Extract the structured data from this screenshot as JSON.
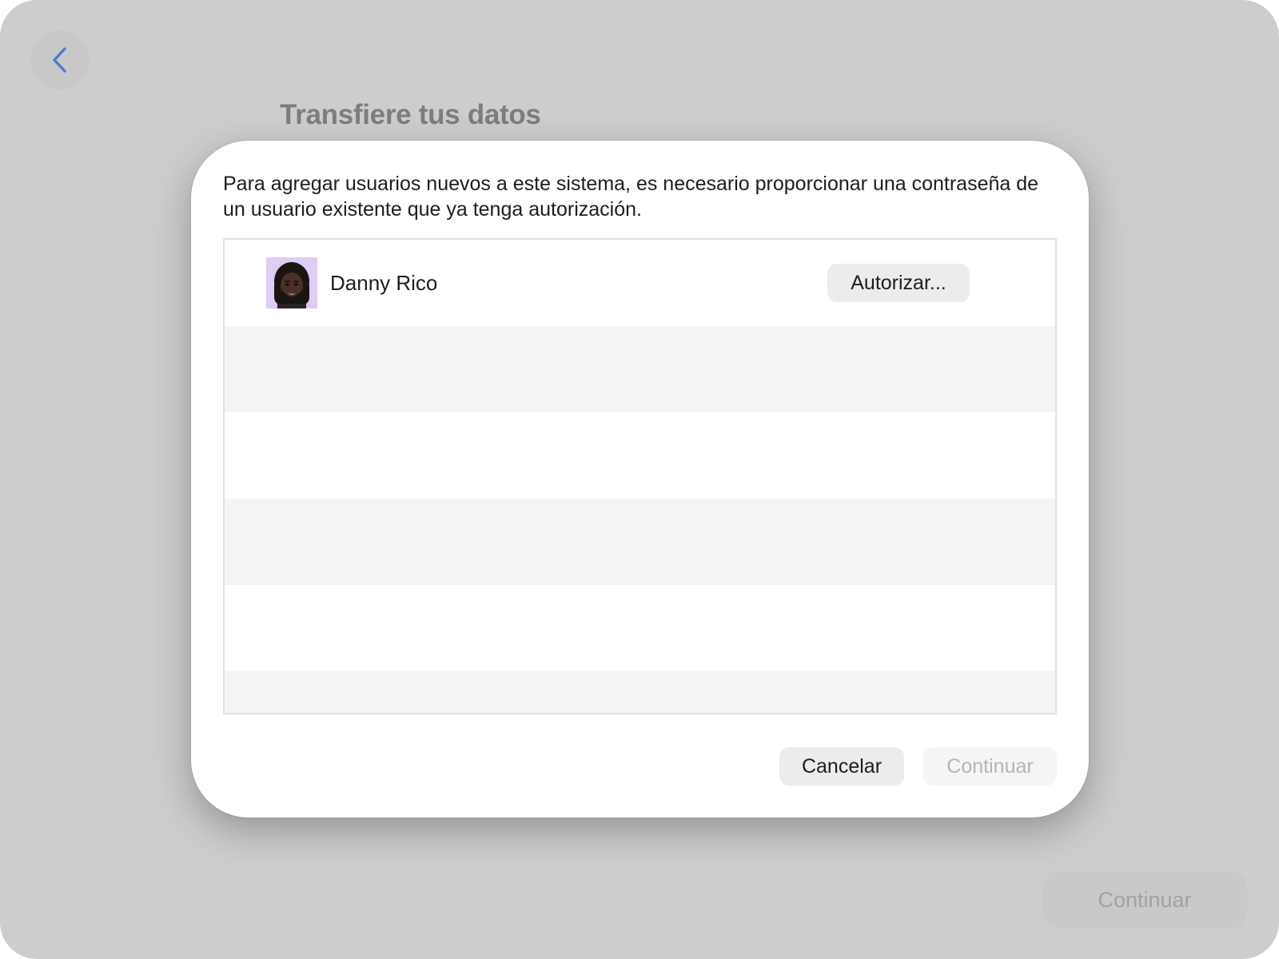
{
  "background": {
    "back_icon": "chevron-left-icon",
    "title": "Transfiere tus datos",
    "continue_label": "Continuar"
  },
  "dialog": {
    "message": "Para agregar usuarios nuevos a este sistema, es necesario proporcionar una contraseña de un usuario existente que ya tenga autorización.",
    "users": [
      {
        "name": "Danny Rico",
        "avatar": "memoji-avatar",
        "authorize_label": "Autorizar..."
      }
    ],
    "cancel_label": "Cancelar",
    "continue_label": "Continuar",
    "continue_enabled": false
  },
  "colors": {
    "accent": "#4a7bd0",
    "window_dimmed": "#cdcdcd",
    "list_alt_row": "#f3f4f4",
    "avatar_background": "#ddcdf2"
  }
}
